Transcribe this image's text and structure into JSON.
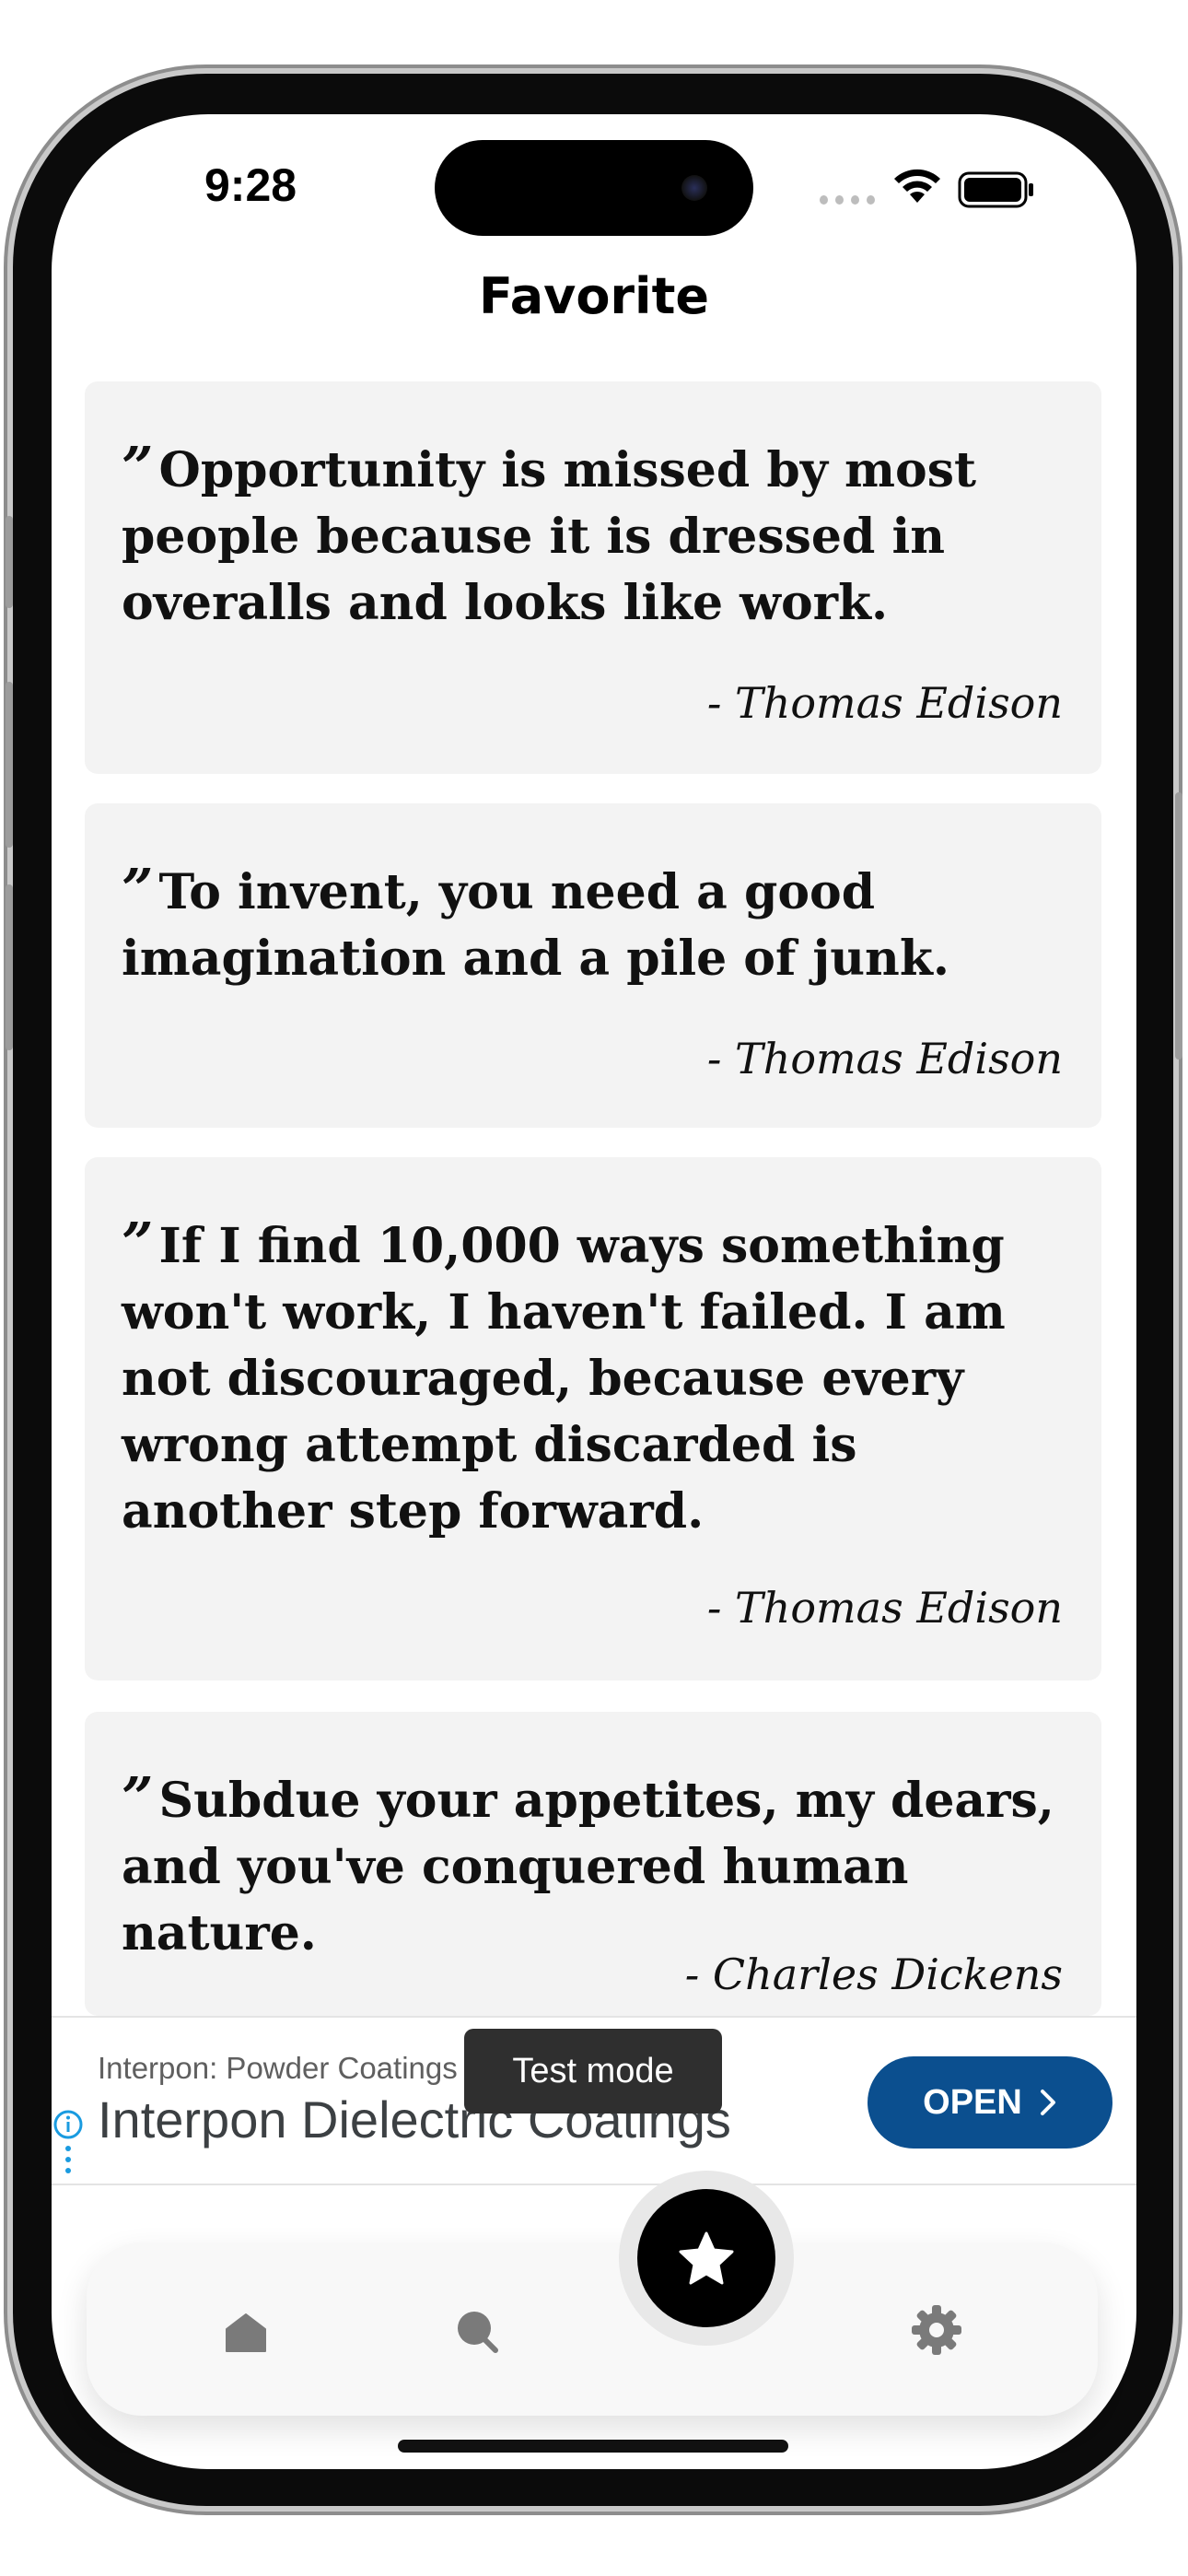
{
  "status": {
    "time": "9:28"
  },
  "header": {
    "title": "Favorite"
  },
  "quotes": [
    {
      "text": "Opportunity is missed by most people because it is dressed in overalls and looks like work.",
      "author": "- Thomas Edison"
    },
    {
      "text": "To invent, you need a good imagination and a pile of junk.",
      "author": "- Thomas Edison"
    },
    {
      "text": "If I find 10,000 ways something won't work, I haven't failed. I am not discouraged, because every wrong attempt discarded is another step forward.",
      "author": "- Thomas Edison"
    },
    {
      "text": "Subdue your appetites, my dears, and you've conquered human nature.",
      "author": "- Charles Dickens"
    }
  ],
  "quote_mark": "”",
  "ad": {
    "advertiser": "Interpon: Powder Coatings",
    "headline": "Interpon Dielectric Coatings",
    "badge": "Test mode",
    "cta": "OPEN"
  },
  "nav": {
    "items": [
      {
        "name": "home",
        "icon": "home-icon"
      },
      {
        "name": "search",
        "icon": "search-icon"
      },
      {
        "name": "favorite",
        "icon": "star-icon",
        "active": true
      },
      {
        "name": "settings",
        "icon": "gear-icon"
      }
    ]
  },
  "colors": {
    "card": "#f3f3f3",
    "cta": "#0b4f8f",
    "fab": "#000000",
    "nav_icon": "#7a7a7a"
  }
}
